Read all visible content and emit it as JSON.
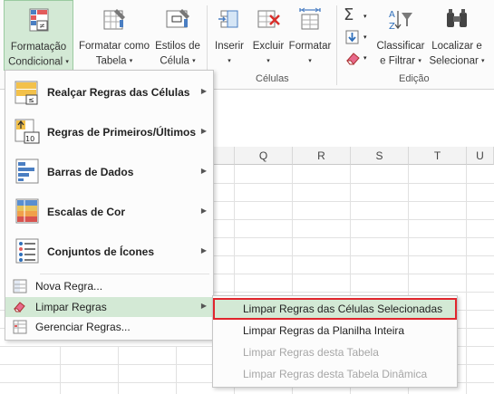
{
  "ribbon": {
    "cond_format": {
      "line1": "Formatação",
      "line2": "Condicional",
      "caret": "▾"
    },
    "format_table": {
      "line1": "Formatar como",
      "line2": "Tabela",
      "caret": "▾"
    },
    "cell_styles": {
      "line1": "Estilos de",
      "line2": "Célula",
      "caret": "▾"
    },
    "insert": {
      "line1": "Inserir",
      "caret": "▾"
    },
    "delete": {
      "line1": "Excluir",
      "caret": "▾"
    },
    "format": {
      "line1": "Formatar",
      "caret": "▾"
    },
    "sort_filter": {
      "line1": "Classificar",
      "line2": "e Filtrar",
      "caret": "▾"
    },
    "find_select": {
      "line1": "Localizar e",
      "line2": "Selecionar",
      "caret": "▾"
    },
    "autosum_caret": "▾",
    "fill_caret": "▾",
    "clear_caret": "▾",
    "group_cells": "Células",
    "group_editing": "Edição"
  },
  "columns": [
    "Q",
    "R",
    "S",
    "T",
    "U"
  ],
  "menu": {
    "items": [
      {
        "label": "Realçar Regras das Células",
        "icon": "highlight-cells-rules-icon"
      },
      {
        "label": "Regras de Primeiros/Últimos",
        "icon": "top-bottom-rules-icon"
      },
      {
        "label": "Barras de Dados",
        "icon": "data-bars-icon"
      },
      {
        "label": "Escalas de Cor",
        "icon": "color-scales-icon"
      },
      {
        "label": "Conjuntos de Ícones",
        "icon": "icon-sets-icon"
      }
    ],
    "new_rule": "Nova Regra...",
    "clear_rules": "Limpar Regras",
    "manage_rules": "Gerenciar Regras...",
    "arrow": "▶"
  },
  "submenu": {
    "items": [
      {
        "label": "Limpar Regras das Células Selecionadas",
        "enabled": true
      },
      {
        "label": "Limpar Regras da Planilha Inteira",
        "enabled": true
      },
      {
        "label": "Limpar Regras desta Tabela",
        "enabled": false
      },
      {
        "label": "Limpar Regras desta Tabela Dinâmica",
        "enabled": false
      }
    ]
  },
  "colors": {
    "highlight": "#d3e9d5",
    "selection_border": "#e0262d",
    "disabled_text": "#a6a6a6"
  }
}
